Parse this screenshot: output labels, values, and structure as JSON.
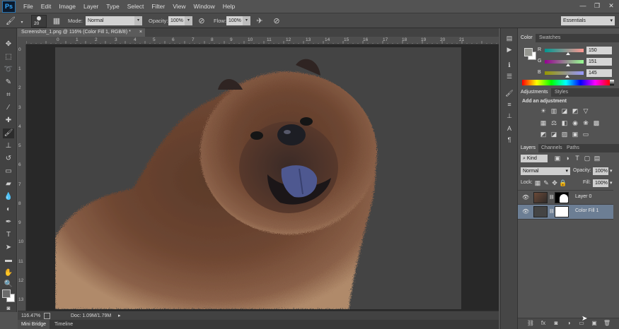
{
  "app": {
    "logo": "Ps"
  },
  "menu": [
    "File",
    "Edit",
    "Image",
    "Layer",
    "Type",
    "Select",
    "Filter",
    "View",
    "Window",
    "Help"
  ],
  "window_controls": {
    "minimize": "—",
    "restore": "❐",
    "close": "✕"
  },
  "options_bar": {
    "brush_size": "20",
    "mode_label": "Mode:",
    "mode_value": "Normal",
    "opacity_label": "Opacity:",
    "opacity_value": "100%",
    "flow_label": "Flow:",
    "flow_value": "100%",
    "workspace": "Essentials"
  },
  "document": {
    "tab_title": "Screenshot_1.png @ 116% (Color Fill 1, RGB/8) *",
    "tab_close": "×"
  },
  "ruler_top": [
    "0",
    "1",
    "2",
    "3",
    "4",
    "5",
    "6",
    "7",
    "8",
    "9",
    "10",
    "11",
    "12",
    "13",
    "14",
    "15",
    "16",
    "17",
    "18",
    "19",
    "20",
    "21"
  ],
  "ruler_left": [
    "0",
    "1",
    "2",
    "3",
    "4",
    "5",
    "6",
    "7",
    "8",
    "9",
    "10",
    "11",
    "12",
    "13"
  ],
  "status": {
    "zoom": "116.47%",
    "doc": "Doc: 1.09M/1.79M"
  },
  "bottom_tabs": [
    "Mini Bridge",
    "Timeline"
  ],
  "color_panel": {
    "tabs": [
      "Color",
      "Swatches"
    ],
    "r_label": "R",
    "r_value": "150",
    "g_label": "G",
    "g_value": "151",
    "b_label": "B",
    "b_value": "145",
    "color_hex": "#969791"
  },
  "adjustments_panel": {
    "tabs": [
      "Adjustments",
      "Styles"
    ],
    "heading": "Add an adjustment"
  },
  "layers_panel": {
    "tabs": [
      "Layers",
      "Channels",
      "Paths"
    ],
    "kind_label": "Kind",
    "blend_mode": "Normal",
    "opacity_label": "Opacity:",
    "opacity_value": "100%",
    "lock_label": "Lock:",
    "fill_label": "Fill:",
    "fill_value": "100%",
    "layers": [
      {
        "name": "Layer 0",
        "selected": false
      },
      {
        "name": "Color Fill 1",
        "selected": true
      }
    ]
  },
  "colors": {
    "fill_color": "#444444",
    "selected_layer": "#6c7e94",
    "accent": "#31a8ff"
  }
}
